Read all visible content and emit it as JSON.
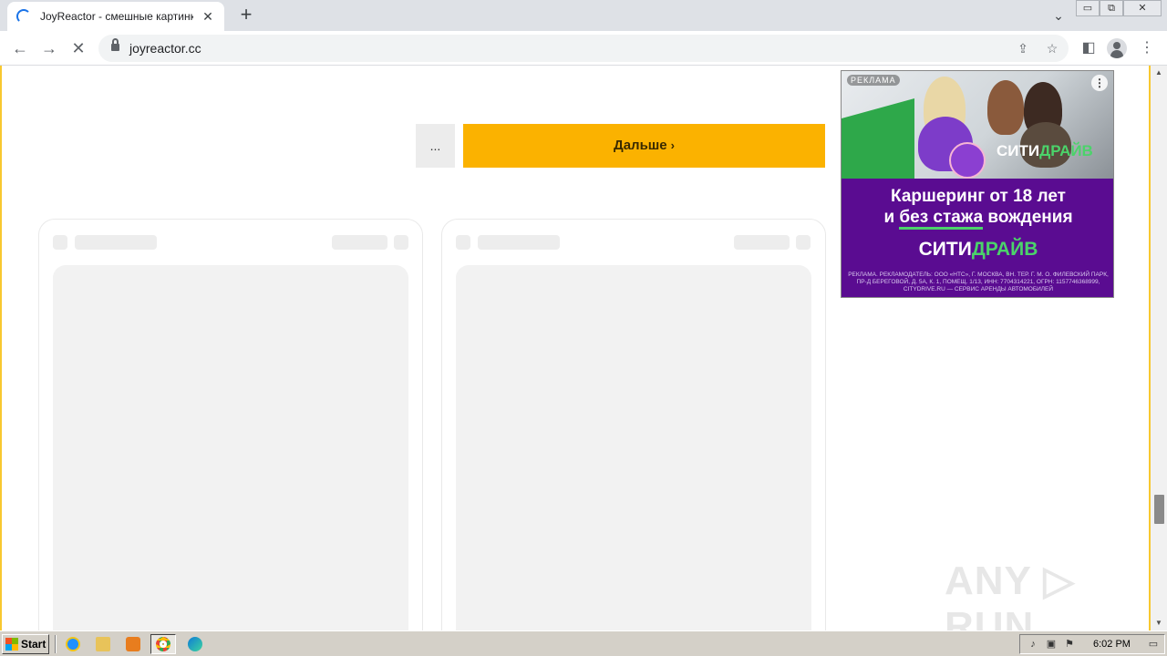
{
  "browser": {
    "tab_title": "JoyReactor - смешные картинки и",
    "tab_close": "✕",
    "new_tab": "+",
    "tab_search": "⌄",
    "window_buttons": {
      "minimize": "▭",
      "restore": "⧉",
      "close": "✕"
    },
    "url": "joyreactor.cc",
    "nav": {
      "back": "←",
      "forward": "→",
      "stop": "✕"
    },
    "omnibox_icons": {
      "share": "⇪",
      "star": "☆"
    },
    "side_panel": "◧",
    "menu": "⋮"
  },
  "page": {
    "dots_label": "...",
    "next_label": "Дальше",
    "next_chevron": "›",
    "ad": {
      "label": "РЕКЛАМА",
      "menu": "⋮",
      "brand_top_a": "СИТИ",
      "brand_top_b": "ДРАЙВ",
      "headline_line1": "Каршеринг от 18 лет",
      "headline_line2_a": "и ",
      "headline_line2_b": "без стажа",
      "headline_line2_c": " вождения",
      "brand_a": "СИТИ",
      "brand_b": "ДРАЙВ",
      "legal": "РЕКЛАМА. РЕКЛАМОДАТЕЛЬ: ООО «НТС», Г. МОСКВА, ВН. ТЕР. Г. М. О. ФИЛЕВСКИЙ ПАРК, ПР-Д БЕРЕГОВОЙ, Д. 5А, К. 1, ПОМЕЩ. 1/13, ИНН: 7704314221, ОГРН: 1157746368999, CITYDRIVE.RU — СЕРВИС АРЕНДЫ АВТОМОБИЛЕЙ",
      "colors": {
        "background": "#5a0c91",
        "accent": "#4bd36a"
      }
    },
    "watermark": "ANY ▷ RUN",
    "scroll_up": "▲",
    "scroll_down": "▼"
  },
  "taskbar": {
    "start_label": "Start",
    "apps": [
      "internet-explorer-icon",
      "file-explorer-icon",
      "media-player-icon",
      "chrome-icon",
      "edge-icon"
    ],
    "clock": "6:02 PM"
  },
  "colors": {
    "accent_yellow": "#fbb200",
    "page_border": "#f8c830"
  }
}
